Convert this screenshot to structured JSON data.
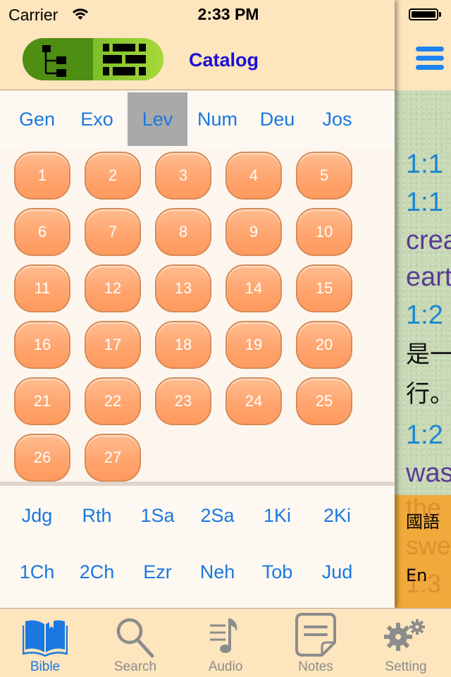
{
  "status_bar": {
    "carrier": "Carrier",
    "time": "2:33 PM",
    "battery_percent": 100
  },
  "navbar": {
    "title": "Catalog",
    "segments": [
      {
        "icon": "tree-hierarchy-icon",
        "selected": false
      },
      {
        "icon": "brick-grid-icon",
        "selected": true
      }
    ]
  },
  "books": {
    "row1": [
      "Gen",
      "Exo",
      "Lev",
      "Num",
      "Deu",
      "Jos"
    ],
    "selected": "Lev",
    "row2": [
      "Jdg",
      "Rth",
      "1Sa",
      "2Sa",
      "1Ki",
      "2Ki"
    ],
    "row3": [
      "1Ch",
      "2Ch",
      "Ezr",
      "Neh",
      "Tob",
      "Jud"
    ]
  },
  "chapters": [
    "1",
    "2",
    "3",
    "4",
    "5",
    "6",
    "7",
    "8",
    "9",
    "10",
    "11",
    "12",
    "13",
    "14",
    "15",
    "16",
    "17",
    "18",
    "19",
    "20",
    "21",
    "22",
    "23",
    "24",
    "25",
    "26",
    "27"
  ],
  "reader": {
    "lines": [
      {
        "kind": "ref",
        "text": "1:1"
      },
      {
        "kind": "ref",
        "text": "1:1"
      },
      {
        "kind": "en",
        "text": "crea"
      },
      {
        "kind": "en",
        "text": "eart"
      },
      {
        "kind": "ref",
        "text": "1:2"
      },
      {
        "kind": "zh",
        "text": "是一"
      },
      {
        "kind": "zh",
        "text": "行。"
      },
      {
        "kind": "ref",
        "text": "1:2"
      },
      {
        "kind": "en",
        "text": "was"
      }
    ],
    "ghost_lines": [
      "the",
      "swe",
      "1:3"
    ],
    "lang_buttons": [
      "國語",
      "En"
    ]
  },
  "tabbar": {
    "tabs": [
      {
        "label": "Bible",
        "icon": "open-book-icon",
        "active": true
      },
      {
        "label": "Search",
        "icon": "magnifier-icon",
        "active": false
      },
      {
        "label": "Audio",
        "icon": "music-list-icon",
        "active": false
      },
      {
        "label": "Notes",
        "icon": "note-icon",
        "active": false
      },
      {
        "label": "Setting",
        "icon": "gears-icon",
        "active": false
      }
    ]
  },
  "colors": {
    "accent_blue": "#1a78e0",
    "title_blue": "#1a10d8",
    "chapter_orange": "#ffa36c",
    "bar_background": "#fde5bd",
    "selected_book_bg": "#a9a9a9",
    "segment_green": "#5e9e1c"
  }
}
